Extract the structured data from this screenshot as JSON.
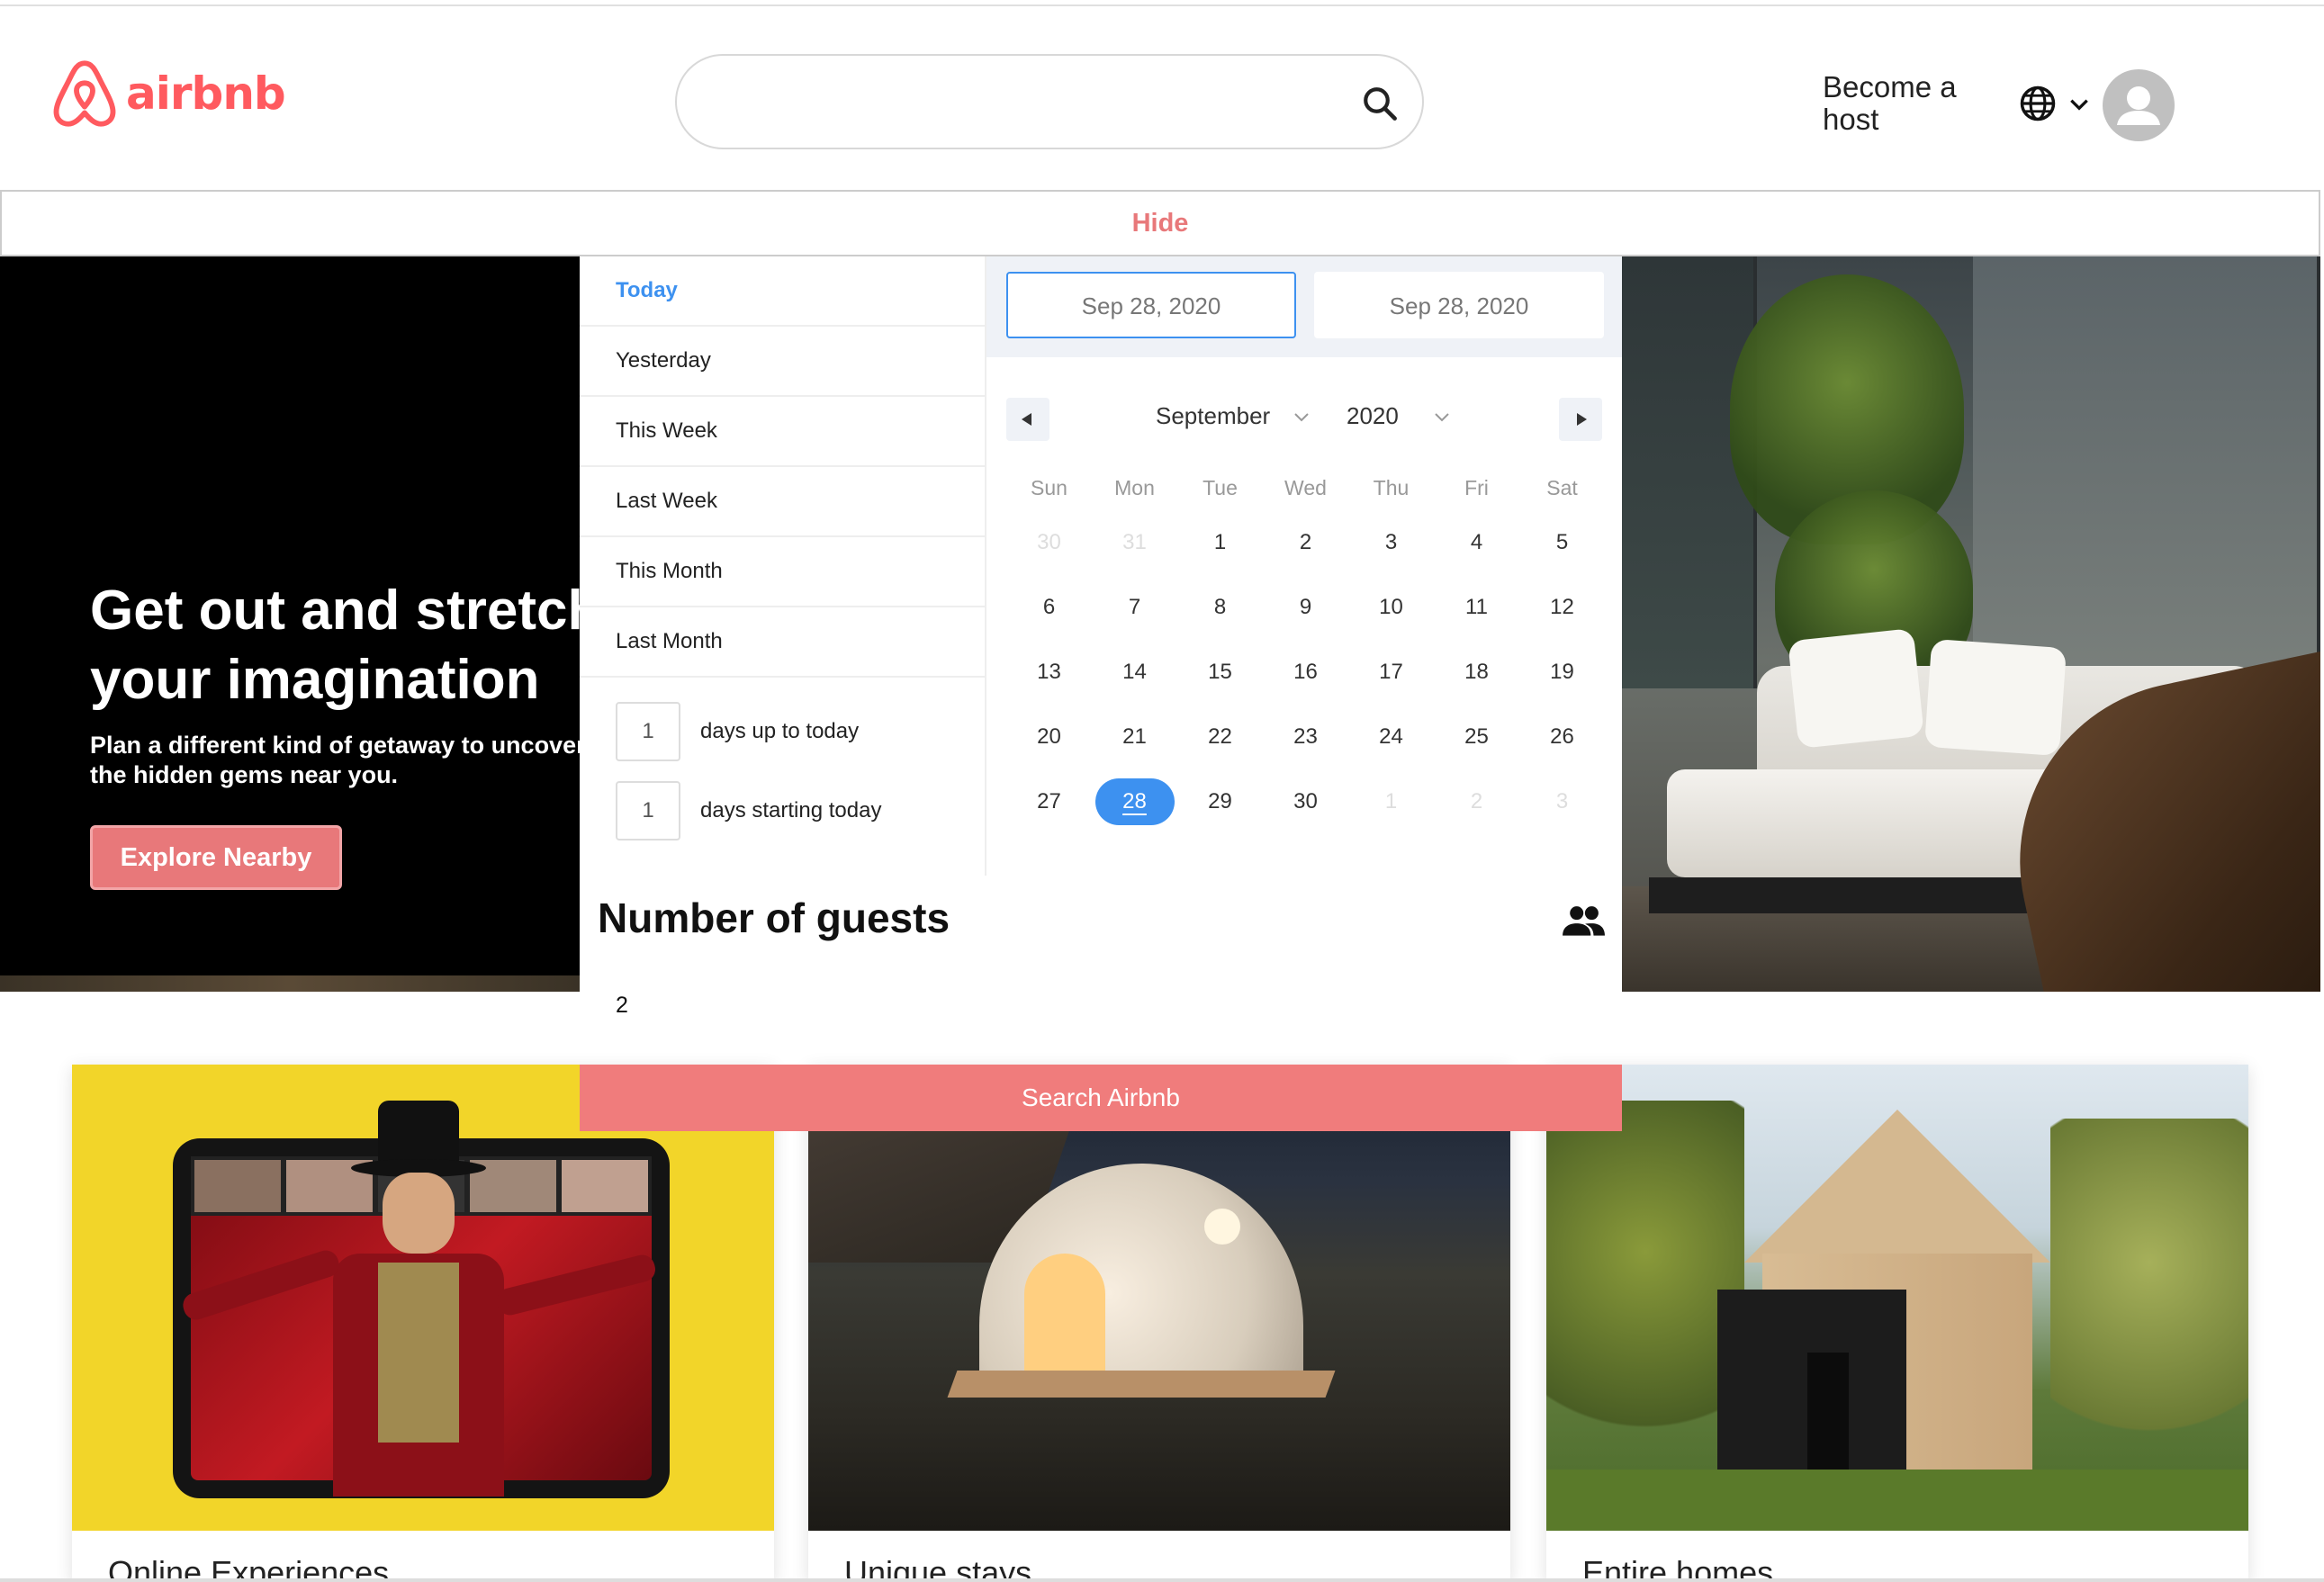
{
  "header": {
    "logo_text": "airbnb",
    "search_placeholder": "",
    "host_link": "Become a host",
    "brand_color": "#FF5A5F",
    "icons": [
      "airbnb-logo-icon",
      "search-icon",
      "globe-icon",
      "chevron-down-icon",
      "user-avatar-icon"
    ]
  },
  "hide_bar": {
    "label": "Hide"
  },
  "hero": {
    "title_line1": "Get out and stretch",
    "title_line2": "your imagination",
    "subtitle_line1": "Plan a different kind of getaway to uncover",
    "subtitle_line2": "the hidden gems near you.",
    "button_label": "Explore Nearby",
    "button_color": "#E8787A"
  },
  "date_picker": {
    "ranges": [
      {
        "label": "Today",
        "active": true
      },
      {
        "label": "Yesterday",
        "active": false
      },
      {
        "label": "This Week",
        "active": false
      },
      {
        "label": "Last Week",
        "active": false
      },
      {
        "label": "This Month",
        "active": false
      },
      {
        "label": "Last Month",
        "active": false
      }
    ],
    "days_up_to_today": {
      "value": "1",
      "label": "days up to today"
    },
    "days_starting_today": {
      "value": "1",
      "label": "days starting today"
    },
    "start_date": "Sep 28, 2020",
    "end_date": "Sep 28, 2020",
    "month": "September",
    "year": "2020",
    "accent_color": "#3d91f0",
    "weekdays": [
      "Sun",
      "Mon",
      "Tue",
      "Wed",
      "Thu",
      "Fri",
      "Sat"
    ],
    "weeks": [
      [
        {
          "d": "30",
          "m": true
        },
        {
          "d": "31",
          "m": true
        },
        {
          "d": "1"
        },
        {
          "d": "2"
        },
        {
          "d": "3"
        },
        {
          "d": "4"
        },
        {
          "d": "5"
        }
      ],
      [
        {
          "d": "6"
        },
        {
          "d": "7"
        },
        {
          "d": "8"
        },
        {
          "d": "9"
        },
        {
          "d": "10"
        },
        {
          "d": "11"
        },
        {
          "d": "12"
        }
      ],
      [
        {
          "d": "13"
        },
        {
          "d": "14"
        },
        {
          "d": "15"
        },
        {
          "d": "16"
        },
        {
          "d": "17"
        },
        {
          "d": "18"
        },
        {
          "d": "19"
        }
      ],
      [
        {
          "d": "20"
        },
        {
          "d": "21"
        },
        {
          "d": "22"
        },
        {
          "d": "23"
        },
        {
          "d": "24"
        },
        {
          "d": "25"
        },
        {
          "d": "26"
        }
      ],
      [
        {
          "d": "27"
        },
        {
          "d": "28",
          "s": true
        },
        {
          "d": "29"
        },
        {
          "d": "30"
        },
        {
          "d": "1",
          "m": true
        },
        {
          "d": "2",
          "m": true
        },
        {
          "d": "3",
          "m": true
        }
      ]
    ]
  },
  "guests": {
    "title": "Number of guests",
    "value": "2",
    "icon": "people-icon"
  },
  "search_button": {
    "label": "Search Airbnb",
    "color": "#F07C7C"
  },
  "cards": [
    {
      "title": "Online Experiences"
    },
    {
      "title": "Unique stays"
    },
    {
      "title": "Entire homes"
    }
  ]
}
